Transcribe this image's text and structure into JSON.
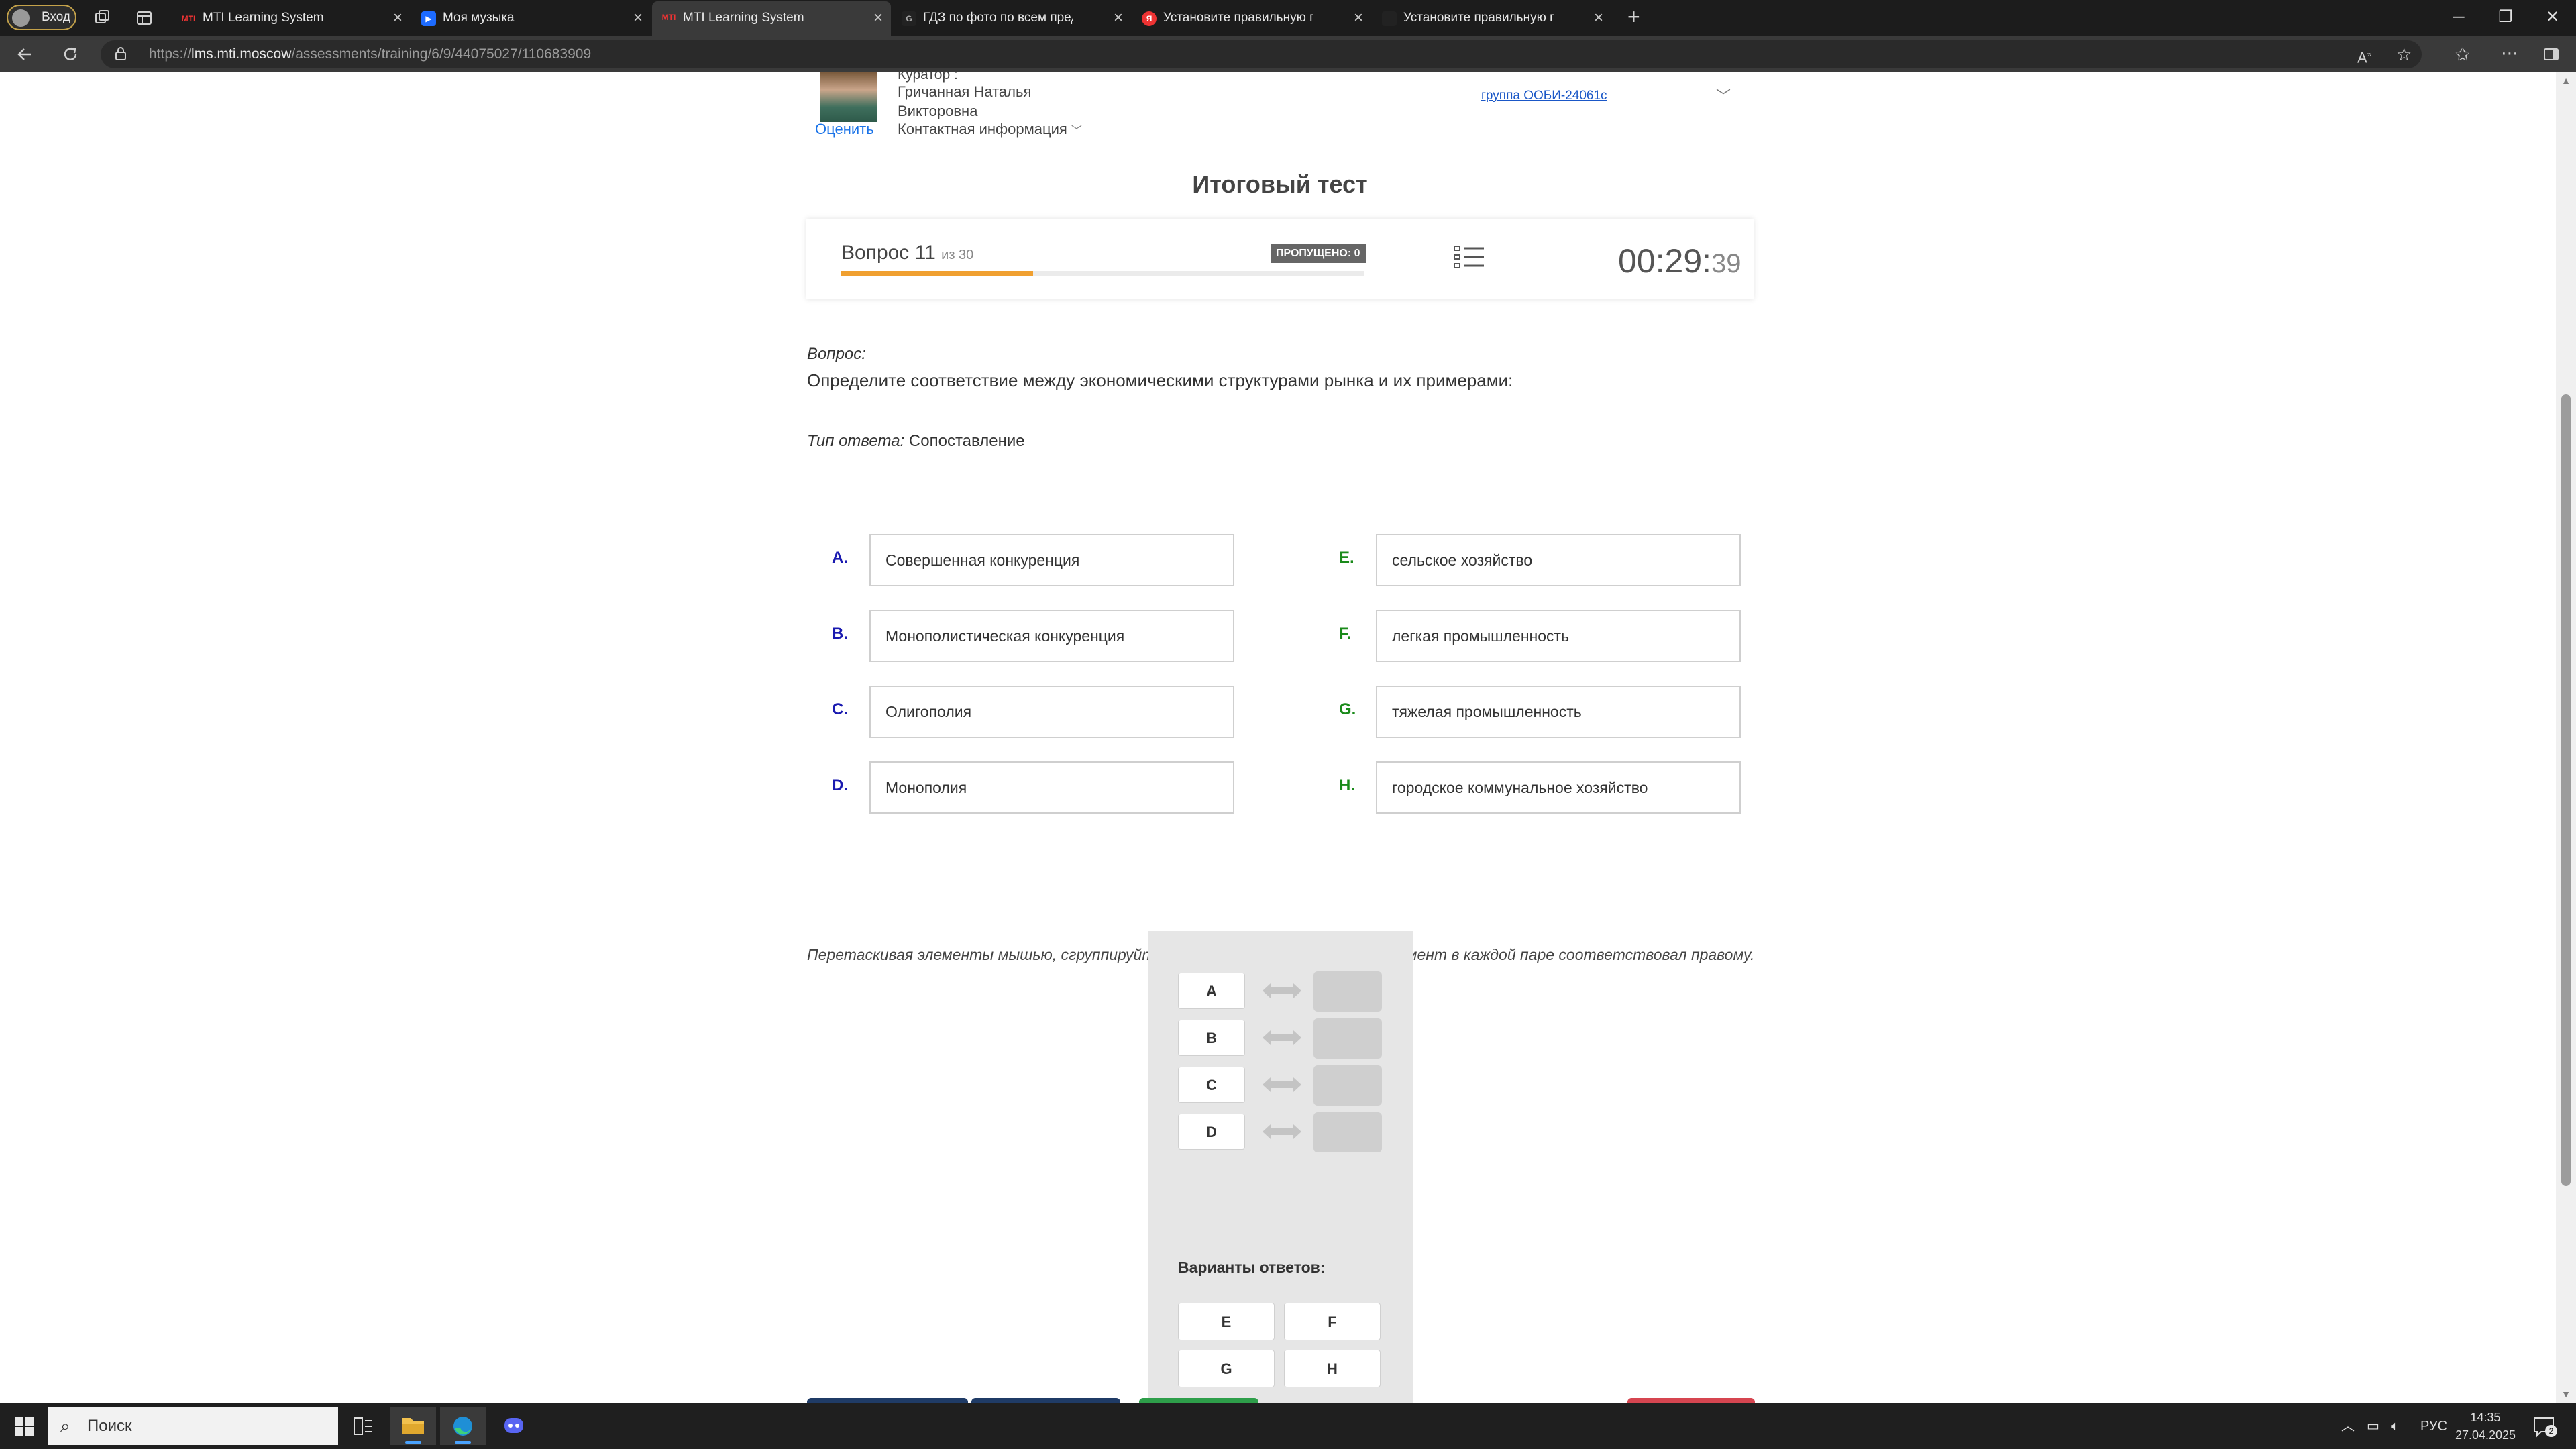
{
  "browser": {
    "profile_label": "Вход",
    "tabs": [
      {
        "title": "MTI Learning System",
        "favicon": "mti-icon",
        "active": false
      },
      {
        "title": "Моя музыка",
        "favicon": "music-icon",
        "active": false
      },
      {
        "title": "MTI Learning System",
        "favicon": "mti-icon",
        "active": true
      },
      {
        "title": "ГДЗ по фото по всем предметам",
        "favicon": "gdz-icon",
        "active": false
      },
      {
        "title": "Установите правильную последо",
        "favicon": "yandex-icon",
        "active": false
      },
      {
        "title": "Установите правильную последо",
        "favicon": "page-icon",
        "active": false
      }
    ],
    "url_prefix": "https://",
    "url_host": "lms.mti.moscow",
    "url_path": "/assessments/training/6/9/44075027/110683909"
  },
  "curator": {
    "top_label": "Куратор :",
    "name": "Гричанная Наталья Викторовна",
    "rate_label": "Оценить",
    "contact_label": "Контактная информация",
    "group_label": "группа ООБИ-24061с"
  },
  "test": {
    "title": "Итоговый тест",
    "question_label": "Вопрос 11",
    "of_label": "из 30",
    "progress_fraction": 0.3667,
    "skipped_label": "ПРОПУЩЕНО: 0",
    "timer_main": "00:29:",
    "timer_sec": "39"
  },
  "question": {
    "label": "Вопрос:",
    "text": "Определите соответствие между экономическими структурами рынка и их примерами:",
    "answer_type_label": "Тип ответа:",
    "answer_type_value": "Сопоставление"
  },
  "left_items": [
    {
      "letter": "A.",
      "text": "Совершенная конкуренция"
    },
    {
      "letter": "B.",
      "text": "Монополистическая конкуренция"
    },
    {
      "letter": "C.",
      "text": "Олигополия"
    },
    {
      "letter": "D.",
      "text": "Монополия"
    }
  ],
  "right_items": [
    {
      "letter": "E.",
      "text": "сельское хозяйство"
    },
    {
      "letter": "F.",
      "text": "легкая промышленность"
    },
    {
      "letter": "G.",
      "text": "тяжелая промышленность"
    },
    {
      "letter": "H.",
      "text": "городское коммунальное хозяйство"
    }
  ],
  "hint": "Перетаскивая элементы мышью, сгруппируйте их в пары так, чтобы левый элемент в каждой паре соответствовал правому.",
  "dnd": {
    "slots": [
      "A",
      "B",
      "C",
      "D"
    ],
    "variants_title": "Варианты ответов:",
    "variants": [
      "E",
      "F",
      "G",
      "H"
    ]
  },
  "taskbar": {
    "search_placeholder": "Поиск",
    "language": "РУС",
    "time": "14:35",
    "date": "27.04.2025",
    "notifications": "2"
  },
  "colors": {
    "accent_progress": "#f0a030",
    "left_letter": "#1a1ab0",
    "right_letter": "#1a8a1a",
    "link": "#1a73e8",
    "btn_blue": "#1f3b66",
    "btn_green": "#2e9e4a",
    "btn_red": "#d64550"
  }
}
